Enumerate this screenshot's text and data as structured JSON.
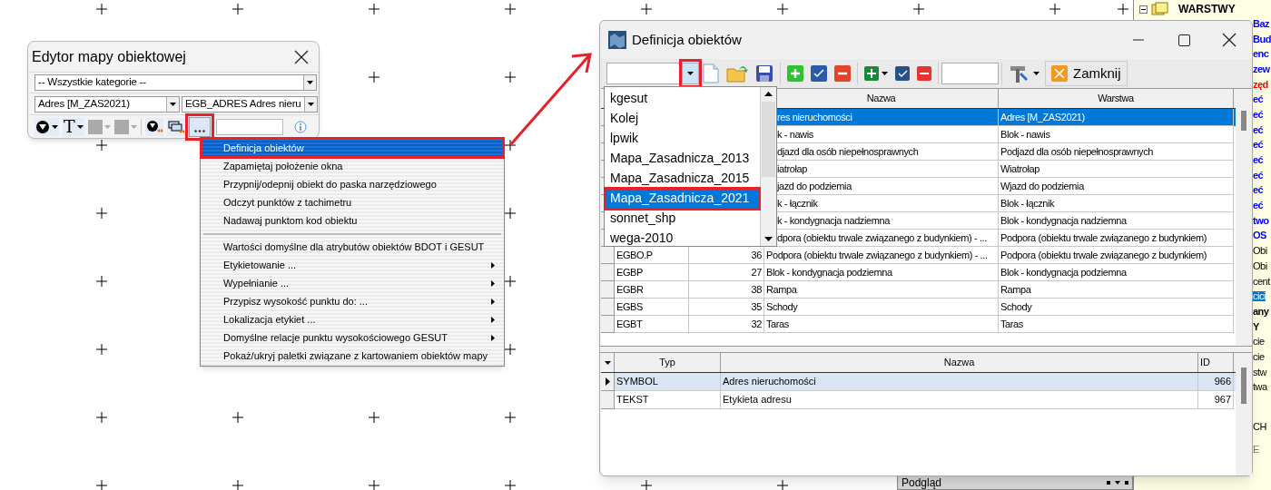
{
  "editor_window": {
    "title": "Edytor mapy obiektowej",
    "category_combo": "-- Wszystkie kategorie --",
    "layer_combo": "Adres [M_ZAS2021)",
    "object_combo": "EGB_ADRES Adres nieru",
    "text_tool": "T",
    "more_button": {
      "highlighted": true
    }
  },
  "context_menu": {
    "items": [
      {
        "kind": "item",
        "label": "Definicja obiektów",
        "selected": true,
        "highlighted": true,
        "submenu": false
      },
      {
        "kind": "item",
        "label": "Zapamiętaj położenie okna",
        "selected": false,
        "highlighted": false,
        "submenu": false
      },
      {
        "kind": "item",
        "label": "Przypnij/odepnij obiekt do paska narzędziowego",
        "selected": false,
        "highlighted": false,
        "submenu": false
      },
      {
        "kind": "item",
        "label": "Odczyt punktów z tachimetru",
        "selected": false,
        "highlighted": false,
        "submenu": false
      },
      {
        "kind": "item",
        "label": "Nadawaj punktom kod obiektu",
        "selected": false,
        "highlighted": false,
        "submenu": false
      },
      {
        "kind": "separator"
      },
      {
        "kind": "item",
        "label": "Wartości domyślne dla atrybutów obiektów BDOT i GESUT",
        "selected": false,
        "highlighted": false,
        "submenu": false
      },
      {
        "kind": "item",
        "label": "Etykietowanie ...",
        "selected": false,
        "highlighted": false,
        "submenu": true
      },
      {
        "kind": "item",
        "label": "Wypełnianie ...",
        "selected": false,
        "highlighted": false,
        "submenu": true
      },
      {
        "kind": "item",
        "label": "Przypisz wysokość punktu do: ...",
        "selected": false,
        "highlighted": false,
        "submenu": true
      },
      {
        "kind": "item",
        "label": "Lokalizacja etykiet ...",
        "selected": false,
        "highlighted": false,
        "submenu": true
      },
      {
        "kind": "item",
        "label": "Domyślne relacje punktu wysokościowego GESUT",
        "selected": false,
        "highlighted": false,
        "submenu": true
      },
      {
        "kind": "item",
        "label": "Pokaż/ukryj paletki związane z kartowaniem obiektów mapy",
        "selected": false,
        "highlighted": false,
        "submenu": false
      }
    ]
  },
  "definition_window": {
    "title": "Definicja obiektów",
    "close_label": "Zamknij",
    "layer_combo": {
      "expanded": true,
      "highlighted": true
    },
    "dropdown_items": [
      {
        "label": "kgesut",
        "selected": false,
        "highlighted": false
      },
      {
        "label": "Kolej",
        "selected": false,
        "highlighted": false
      },
      {
        "label": "lpwik",
        "selected": false,
        "highlighted": false
      },
      {
        "label": "Mapa_Zasadnicza_2013",
        "selected": false,
        "highlighted": false
      },
      {
        "label": "Mapa_Zasadnicza_2015",
        "selected": false,
        "highlighted": false
      },
      {
        "label": "Mapa_Zasadnicza_2021",
        "selected": true,
        "highlighted": true
      },
      {
        "label": "sonnet_shp",
        "selected": false,
        "highlighted": false
      },
      {
        "label": "wega-2010",
        "selected": false,
        "highlighted": false
      }
    ],
    "objects_table": {
      "columns": [
        "Nazwa",
        "Warstwa"
      ],
      "rows": [
        {
          "nazwa": "res nieruchomości",
          "warstwa": "Adres [M_ZAS2021)",
          "selected": true
        },
        {
          "nazwa": "k - nawis",
          "warstwa": "Blok - nawis",
          "selected": false
        },
        {
          "nazwa": "djazd dla osób niepełnosprawnych",
          "warstwa": "Podjazd dla osób niepełnosprawnych",
          "selected": false
        },
        {
          "nazwa": "iatrołap",
          "warstwa": "Wiatrołap",
          "selected": false
        },
        {
          "nazwa": "jazd do podziemia",
          "warstwa": "Wjazd do podziemia",
          "selected": false
        },
        {
          "nazwa": "k - łącznik",
          "warstwa": "Blok - łącznik",
          "selected": false
        },
        {
          "nazwa": "k - kondygnacja nadziemna",
          "warstwa": "Blok - kondygnacja nadziemna",
          "selected": false
        },
        {
          "nazwa": "dpora (obiektu trwale związanego z budynkiem) - ...",
          "warstwa": "Podpora (obiektu trwale związanego z budynkiem)",
          "selected": false
        },
        {
          "code": "EGBO.P",
          "number": "36",
          "nazwa": "Podpora (obiektu trwale związanego z budynkiem) - ...",
          "warstwa": "Podpora (obiektu trwale związanego z budynkiem)",
          "selected": false
        },
        {
          "code": "EGBP",
          "number": "27",
          "nazwa": "Blok - kondygnacja podziemna",
          "warstwa": "Blok - kondygnacja podziemna",
          "selected": false
        },
        {
          "code": "EGBR",
          "number": "38",
          "nazwa": "Rampa",
          "warstwa": "Rampa",
          "selected": false
        },
        {
          "code": "EGBS",
          "number": "35",
          "nazwa": "Schody",
          "warstwa": "Schody",
          "selected": false
        },
        {
          "code": "EGBT",
          "number": "32",
          "nazwa": "Taras",
          "warstwa": "Taras",
          "selected": false
        }
      ]
    },
    "elements_table": {
      "columns": [
        "Typ",
        "Nazwa",
        "ID"
      ],
      "rows": [
        {
          "typ": "SYMBOL",
          "nazwa": "Adres nieruchomości",
          "id": "966",
          "selected": true
        },
        {
          "typ": "TEKST",
          "nazwa": "Etykieta adresu",
          "id": "967",
          "selected": false
        }
      ]
    }
  },
  "layers_panel": {
    "title": "WARSTWY",
    "lines": [
      {
        "text": "Baz",
        "kind": "bold-blue"
      },
      {
        "text": "Bud",
        "kind": "bold-blue"
      },
      {
        "text": "enc",
        "kind": "bold-blue"
      },
      {
        "text": "zew",
        "kind": "bold-blue"
      },
      {
        "text": "zęd",
        "kind": "bold-red"
      },
      {
        "text": "eć",
        "kind": "bold-blue"
      },
      {
        "text": "eć",
        "kind": "bold-blue"
      },
      {
        "text": "eć",
        "kind": "bold-blue"
      },
      {
        "text": "eć",
        "kind": "bold-blue"
      },
      {
        "text": "eć",
        "kind": "bold-blue"
      },
      {
        "text": "eć",
        "kind": "bold-blue"
      },
      {
        "text": "eć",
        "kind": "bold-blue"
      },
      {
        "text": "eć",
        "kind": "bold-blue"
      },
      {
        "text": "two",
        "kind": "bold-blue"
      },
      {
        "text": "OS",
        "kind": "bold-blue"
      },
      {
        "text": "Obi",
        "kind": "plain"
      },
      {
        "text": "Obi",
        "kind": "plain"
      },
      {
        "text": "cent",
        "kind": "plain"
      },
      {
        "text": "cici",
        "kind": "selected"
      },
      {
        "text": "any",
        "kind": "bold"
      },
      {
        "text": "Y",
        "kind": "bold"
      },
      {
        "text": "cie",
        "kind": "plain"
      },
      {
        "text": "cie",
        "kind": "plain"
      },
      {
        "text": "stw",
        "kind": "plain"
      },
      {
        "text": "twa",
        "kind": "plain"
      }
    ],
    "lower_lines": [
      {
        "text": "CH",
        "kind": "plain"
      },
      {
        "text": "E",
        "kind": "muted"
      }
    ]
  },
  "preview_bar": {
    "title": "Podgląd"
  }
}
